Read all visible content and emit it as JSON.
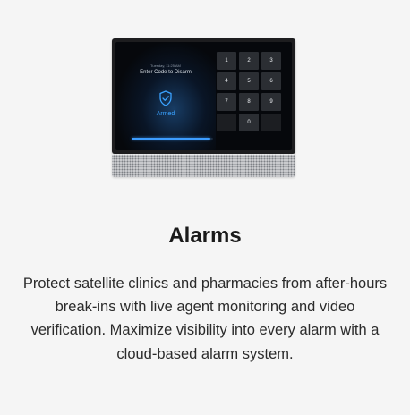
{
  "device": {
    "screen": {
      "date_time": "Tuesday, 11:25 AM",
      "prompt": "Enter Code to Disarm",
      "status": "Armed",
      "status_icon": "shield-check-icon",
      "progress_fraction": 0.97
    },
    "keypad": {
      "keys": [
        "1",
        "2",
        "3",
        "4",
        "5",
        "6",
        "7",
        "8",
        "9",
        "",
        "0",
        ""
      ]
    }
  },
  "feature": {
    "title": "Alarms",
    "description": "Protect satellite clinics and pharmacies from after-hours break-ins with live agent monitoring and video verification. Maximize visibility into every alarm with a cloud-based alarm system."
  },
  "colors": {
    "background": "#f5f5f5",
    "accent": "#3d9dff",
    "title": "#1a1a1a",
    "body_text": "#2b2b2b"
  }
}
